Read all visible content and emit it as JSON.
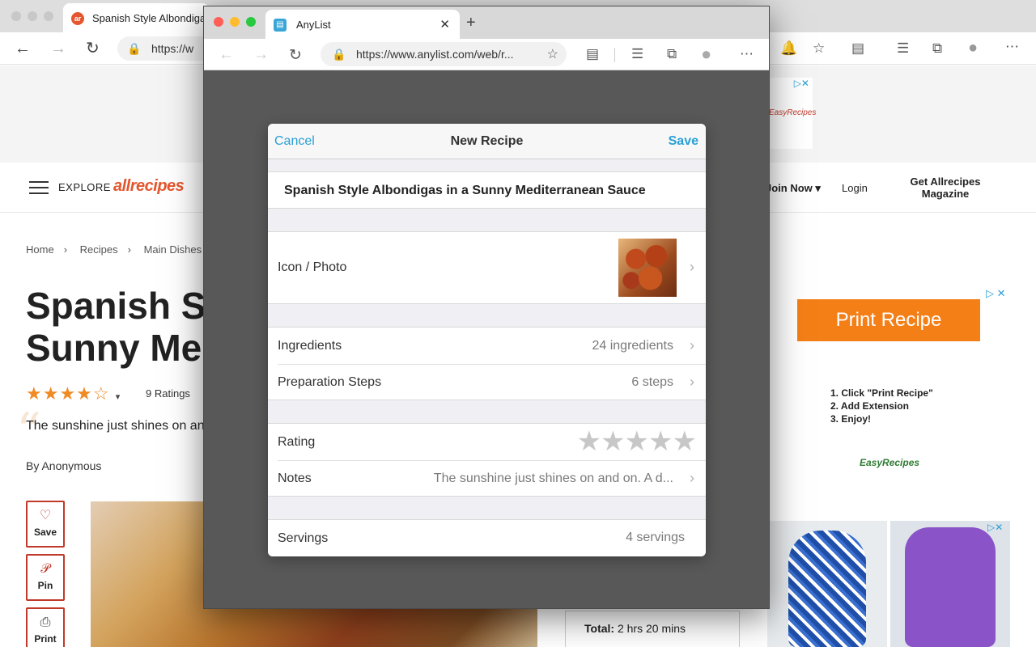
{
  "background_browser": {
    "tab_title": "Spanish Style Albondigas in a Sunny Mediterranean Sauce",
    "tab_favicon": "ar",
    "url": "https://w",
    "nav": {
      "explore": "EXPLORE",
      "logo": "allrecipes",
      "join": "Join Now",
      "login": "Login",
      "magazine": "Get Allrecipes Magazine"
    },
    "breadcrumbs": [
      "Home",
      "Recipes",
      "Main Dishes"
    ],
    "title_line1": "Spanish Sty",
    "title_line2": "Sunny Med",
    "stars": "★★★★☆",
    "ratings": "9 Ratings",
    "quote": "The sunshine just shines on and on.",
    "by_prefix": "By",
    "by_author": "Anonymous",
    "side_buttons": [
      {
        "icon": "heart-icon",
        "label": "Save"
      },
      {
        "icon": "pinterest-icon",
        "label": "Pin"
      },
      {
        "icon": "printer-icon",
        "label": "Print"
      }
    ],
    "ad_print_recipe": "Print Recipe",
    "ad_steps": [
      "1. Click \"Print Recipe\"",
      "2. Add Extension",
      "3. Enjoy!"
    ],
    "ad_brand": "EasyRecipes",
    "total_label": "Total:",
    "total_value": "2 hrs 20 mins"
  },
  "anylist_window": {
    "tab_title": "AnyList",
    "url": "https://www.anylist.com/web/r...",
    "dialog": {
      "cancel": "Cancel",
      "title": "New Recipe",
      "save": "Save",
      "recipe_name": "Spanish Style Albondigas in a Sunny Mediterranean Sauce",
      "icon_photo_label": "Icon / Photo",
      "ingredients_label": "Ingredients",
      "ingredients_value": "24 ingredients",
      "steps_label": "Preparation Steps",
      "steps_value": "6 steps",
      "rating_label": "Rating",
      "rating_value": 0,
      "notes_label": "Notes",
      "notes_value": "The sunshine just shines on and on. A d...",
      "servings_label": "Servings",
      "servings_value": "4 servings"
    }
  },
  "colors": {
    "accent": "#2a9fd6",
    "allrecipes_brand": "#e4572e",
    "ad_orange": "#f57f17",
    "backdrop": "#585858"
  }
}
